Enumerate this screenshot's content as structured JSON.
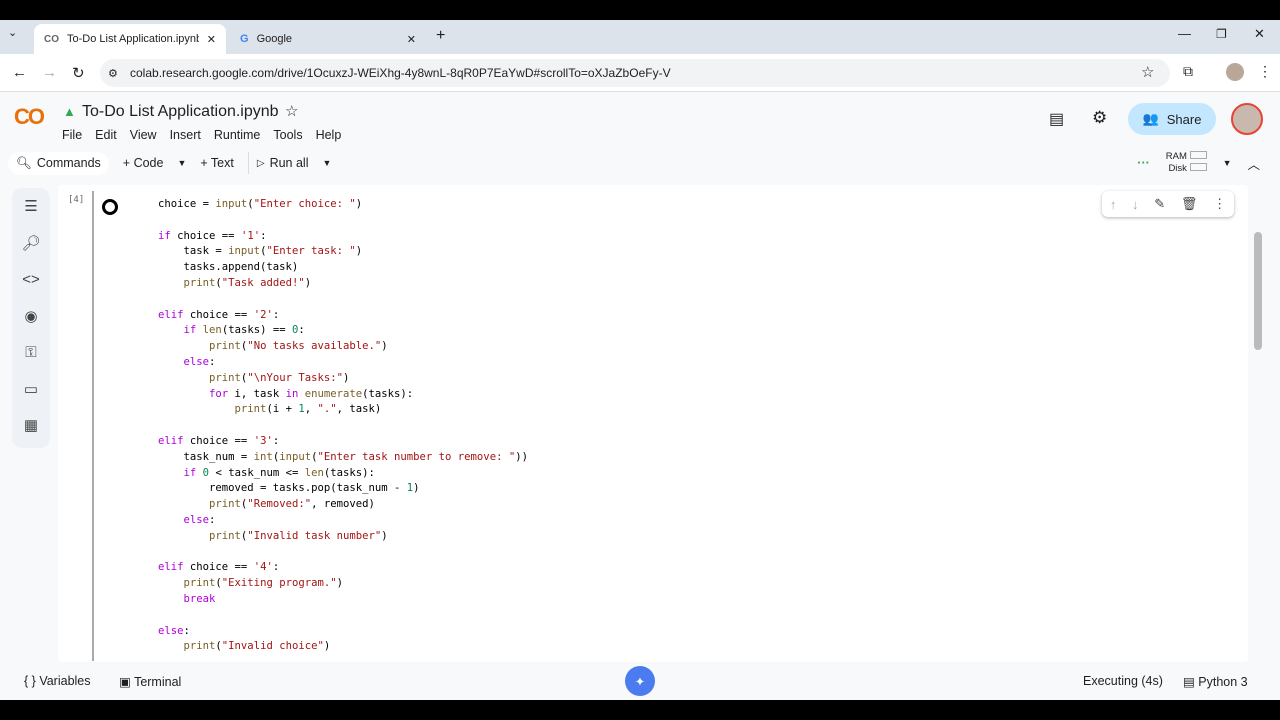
{
  "browser": {
    "tabs": [
      {
        "title": "To-Do List Application.ipynb - C",
        "icon": "colab-icon",
        "active": true
      },
      {
        "title": "Google",
        "icon": "google-icon",
        "active": false
      }
    ],
    "url": "colab.research.google.com/drive/1OcuxzJ-WEiXhg-4y8wnL-8qR0P7EaYwD#scrollTo=oXJaZbOeFy-V"
  },
  "notebook": {
    "logo": "CO",
    "title": "To-Do List Application.ipynb",
    "menu": [
      "File",
      "Edit",
      "View",
      "Insert",
      "Runtime",
      "Tools",
      "Help"
    ],
    "share_label": "Share"
  },
  "toolbar": {
    "commands": "Commands",
    "code": "+ Code",
    "text": "+ Text",
    "run_all": "Run all",
    "ram": "RAM",
    "disk": "Disk"
  },
  "cell": {
    "exec_count": "[4]",
    "lines": [
      "choice = input(\"Enter choice: \")",
      "",
      "if choice == '1':",
      "    task = input(\"Enter task: \")",
      "    tasks.append(task)",
      "    print(\"Task added!\")",
      "",
      "elif choice == '2':",
      "    if len(tasks) == 0:",
      "        print(\"No tasks available.\")",
      "    else:",
      "        print(\"\\nYour Tasks:\")",
      "        for i, task in enumerate(tasks):",
      "            print(i + 1, \".\", task)",
      "",
      "elif choice == '3':",
      "    task_num = int(input(\"Enter task number to remove: \"))",
      "    if 0 < task_num <= len(tasks):",
      "        removed = tasks.pop(task_num - 1)",
      "        print(\"Removed:\", removed)",
      "    else:",
      "        print(\"Invalid task number\")",
      "",
      "elif choice == '4':",
      "    print(\"Exiting program.\")",
      "    break",
      "",
      "else:",
      "    print(\"Invalid choice\")"
    ]
  },
  "status": {
    "variables": "Variables",
    "terminal": "Terminal",
    "executing": "Executing (4s)",
    "runtime": "Python 3"
  },
  "colors": {
    "accent": "#0b57d0",
    "share_bg": "#c2e7ff",
    "keyword": "#af00db",
    "builtin": "#795e26",
    "string": "#a31515",
    "number": "#098658"
  }
}
